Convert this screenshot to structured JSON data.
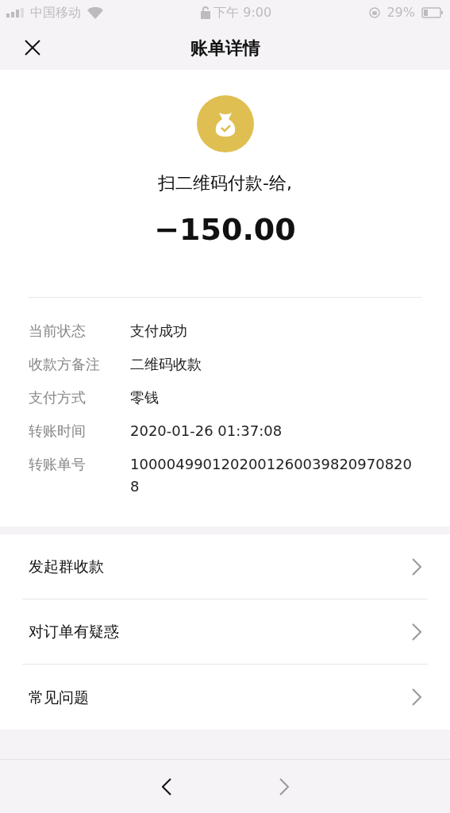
{
  "status_bar": {
    "carrier": "中国移动",
    "time": "下午 9:00",
    "battery": "29%"
  },
  "header": {
    "title": "账单详情"
  },
  "summary": {
    "merchant": "扫二维码付款-给,",
    "amount": "−150.00"
  },
  "details": [
    {
      "label": "当前状态",
      "value": "支付成功"
    },
    {
      "label": "收款方备注",
      "value": "二维码收款"
    },
    {
      "label": "支付方式",
      "value": "零钱"
    },
    {
      "label": "转账时间",
      "value": "2020-01-26 01:37:08"
    },
    {
      "label": "转账单号",
      "value": "10000499012020012600398209708208"
    }
  ],
  "menu": [
    "发起群收款",
    "对订单有疑惑",
    "常见问题"
  ],
  "nav": {
    "back_disabled": false,
    "forward_disabled": true
  }
}
